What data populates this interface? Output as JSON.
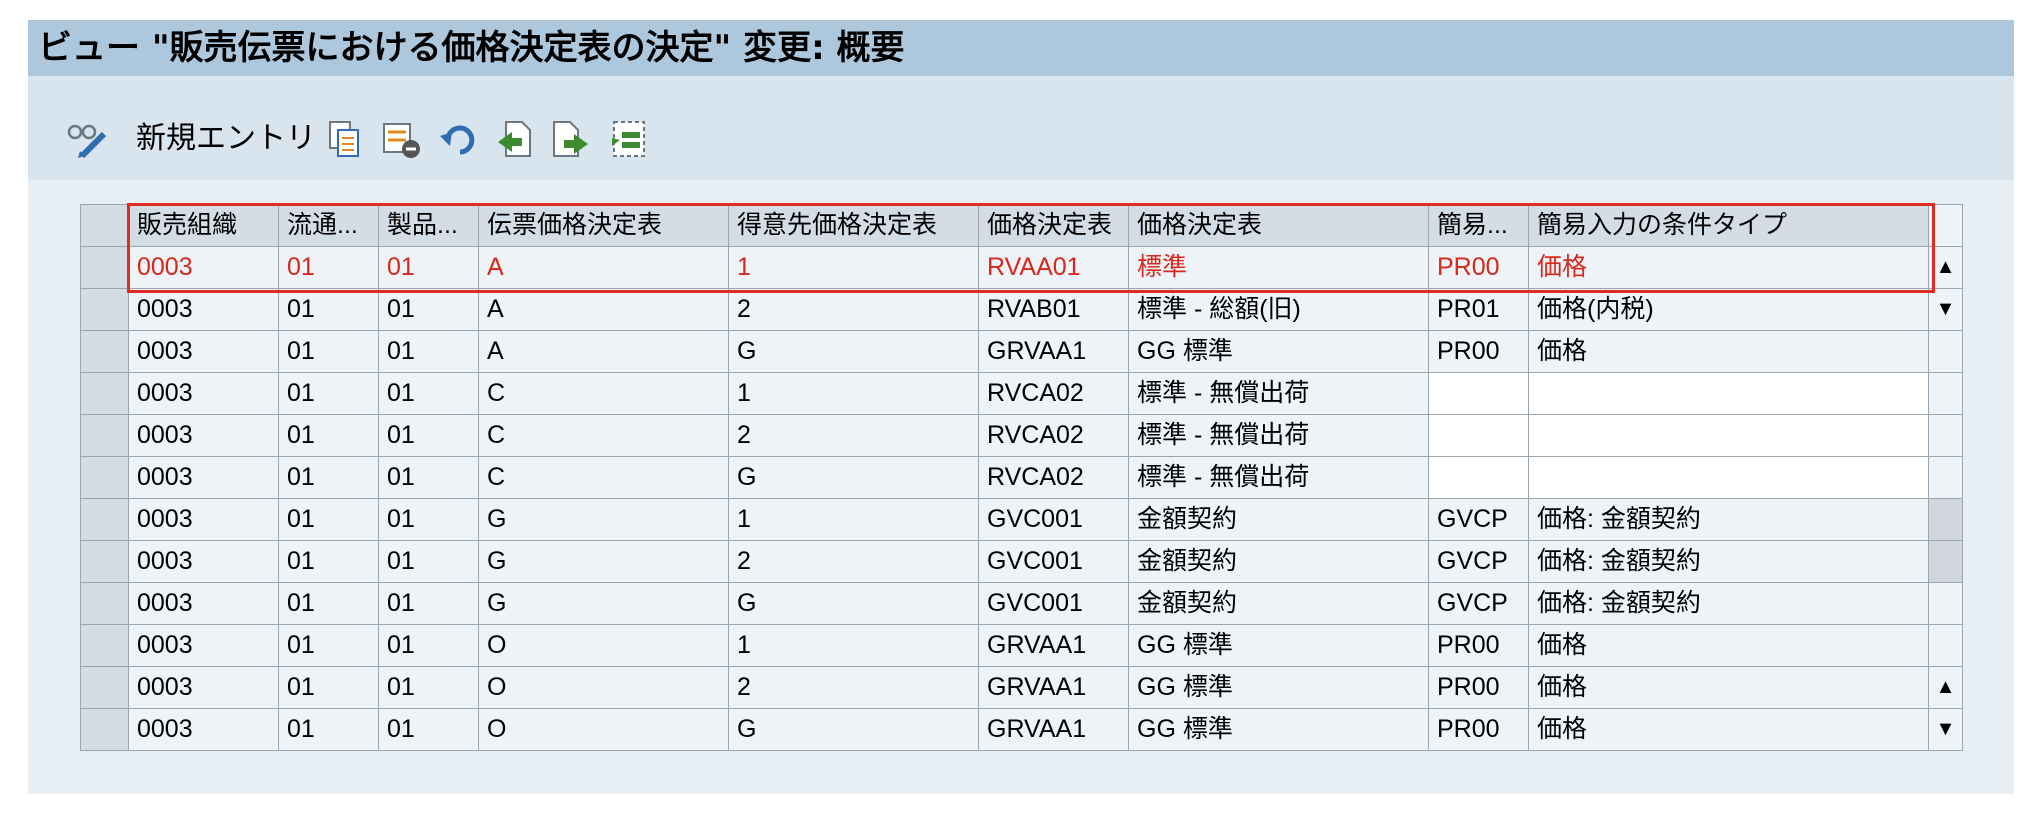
{
  "title": "ビュー \"販売伝票における価格決定表の決定\" 変更: 概要",
  "toolbar": {
    "new_entries_label": "新規エントリ",
    "icons": [
      "glasses-pencil-icon",
      "copy-icon",
      "delete-rows-icon",
      "undo-icon",
      "previous-entry-icon",
      "next-entry-icon",
      "select-block-icon"
    ]
  },
  "table": {
    "columns": [
      "販売組織",
      "流通...",
      "製品...",
      "伝票価格決定表",
      "得意先価格決定表",
      "価格決定表",
      "価格決定表",
      "簡易...",
      "簡易入力の条件タイプ"
    ],
    "rows": [
      [
        "0003",
        "01",
        "01",
        "A",
        "1",
        "RVAA01",
        "標準",
        "PR00",
        "価格"
      ],
      [
        "0003",
        "01",
        "01",
        "A",
        "2",
        "RVAB01",
        "標準 - 総額(旧)",
        "PR01",
        "価格(内税)"
      ],
      [
        "0003",
        "01",
        "01",
        "A",
        "G",
        "GRVAA1",
        "GG 標準",
        "PR00",
        "価格"
      ],
      [
        "0003",
        "01",
        "01",
        "C",
        "1",
        "RVCA02",
        "標準 - 無償出荷",
        "",
        ""
      ],
      [
        "0003",
        "01",
        "01",
        "C",
        "2",
        "RVCA02",
        "標準 - 無償出荷",
        "",
        ""
      ],
      [
        "0003",
        "01",
        "01",
        "C",
        "G",
        "RVCA02",
        "標準 - 無償出荷",
        "",
        ""
      ],
      [
        "0003",
        "01",
        "01",
        "G",
        "1",
        "GVC001",
        "金額契約",
        "GVCP",
        "価格: 金額契約"
      ],
      [
        "0003",
        "01",
        "01",
        "G",
        "2",
        "GVC001",
        "金額契約",
        "GVCP",
        "価格: 金額契約"
      ],
      [
        "0003",
        "01",
        "01",
        "G",
        "G",
        "GVC001",
        "金額契約",
        "GVCP",
        "価格: 金額契約"
      ],
      [
        "0003",
        "01",
        "01",
        "O",
        "1",
        "GRVAA1",
        "GG 標準",
        "PR00",
        "価格"
      ],
      [
        "0003",
        "01",
        "01",
        "O",
        "2",
        "GRVAA1",
        "GG 標準",
        "PR00",
        "価格"
      ],
      [
        "0003",
        "01",
        "01",
        "O",
        "G",
        "GRVAA1",
        "GG 標準",
        "PR00",
        "価格"
      ]
    ],
    "highlight_row": 0,
    "highlight_color": "#de2b23"
  },
  "scrollbar": {
    "up_arrow": "▲",
    "down_arrow": "▼"
  }
}
